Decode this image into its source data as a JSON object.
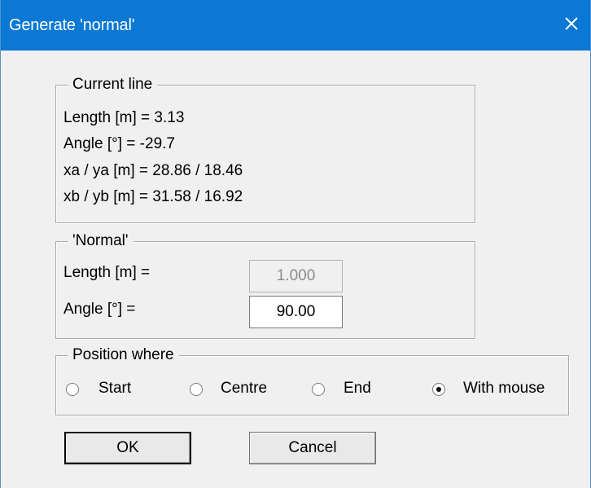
{
  "window": {
    "title": "Generate 'normal'",
    "close_icon": "close-icon"
  },
  "current_line": {
    "legend": "Current line",
    "length": "Length [m] = 3.13",
    "angle": "Angle [°] = -29.7",
    "xa_ya": "xa / ya [m] = 28.86 / 18.46",
    "xb_yb": "xb / yb [m] = 31.58 / 16.92"
  },
  "normal": {
    "legend": "'Normal'",
    "length_label": "Length [m] =",
    "length_value": "1.000",
    "angle_label": "Angle [°] =",
    "angle_value": "90.00"
  },
  "position": {
    "legend": "Position where",
    "options": [
      {
        "label": "Start",
        "checked": false
      },
      {
        "label": "Centre",
        "checked": false
      },
      {
        "label": "End",
        "checked": false
      },
      {
        "label": "With mouse",
        "checked": true
      }
    ]
  },
  "buttons": {
    "ok": "OK",
    "cancel": "Cancel"
  },
  "colors": {
    "titlebar": "#0a78d4",
    "dialog_bg": "#f0f0f0"
  }
}
